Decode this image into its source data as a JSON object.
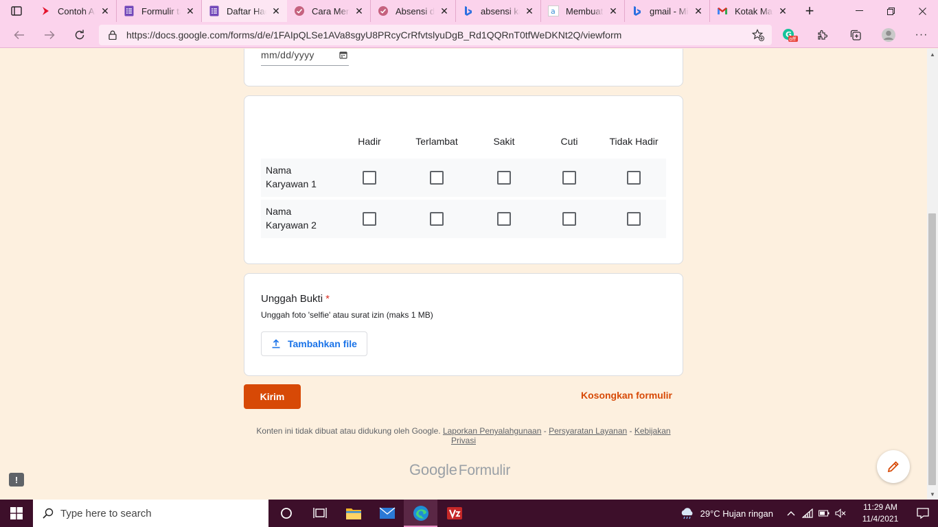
{
  "browser": {
    "tabs": [
      {
        "title": "Contoh Absensi",
        "icon": "youtube-icon"
      },
      {
        "title": "Formulir tanpa judul",
        "icon": "google-forms-icon"
      },
      {
        "title": "Daftar Hadir",
        "icon": "google-forms-icon",
        "active": true
      },
      {
        "title": "Cara Membuat",
        "icon": "site-icon"
      },
      {
        "title": "Absensi dengan",
        "icon": "site-icon"
      },
      {
        "title": "absensi karyawan",
        "icon": "bing-icon"
      },
      {
        "title": "Membuat",
        "icon": "site-icon"
      },
      {
        "title": "gmail - Microsoft",
        "icon": "bing-icon"
      },
      {
        "title": "Kotak Masuk",
        "icon": "gmail-icon"
      }
    ],
    "url": "https://docs.google.com/forms/d/e/1FAIpQLSe1AVa8sgyU8PRcyCrRfvtslyuDgB_Rd1QQRnT0tfWeDKNt2Q/viewform",
    "extension_badge": "off"
  },
  "form": {
    "date_placeholder": "mm/dd/yyyy",
    "grid": {
      "columns": [
        "Hadir",
        "Terlambat",
        "Sakit",
        "Cuti",
        "Tidak Hadir"
      ],
      "rows": [
        "Nama Karyawan 1",
        "Nama Karyawan 2"
      ]
    },
    "upload": {
      "title": "Unggah Bukti",
      "required_mark": "*",
      "description": "Unggah foto 'selfie' atau surat izin (maks 1 MB)",
      "button": "Tambahkan file"
    },
    "submit_label": "Kirim",
    "clear_label": "Kosongkan formulir",
    "footer": {
      "text": "Konten ini tidak dibuat atau didukung oleh Google.",
      "link_abuse": "Laporkan Penyalahgunaan",
      "link_terms": "Persyaratan Layanan",
      "link_privacy": "Kebijakan Privasi",
      "separator": "-"
    },
    "logo_google": "Google",
    "logo_forms": "Formulir"
  },
  "taskbar": {
    "search_placeholder": "Type here to search",
    "weather": "29°C  Hujan ringan",
    "time": "11:29 AM",
    "date": "11/4/2021"
  },
  "colors": {
    "accent": "#d74906",
    "page_bg": "#fdf0df",
    "browser_chrome": "#fbd3ec",
    "taskbar": "#3d0f2a"
  }
}
